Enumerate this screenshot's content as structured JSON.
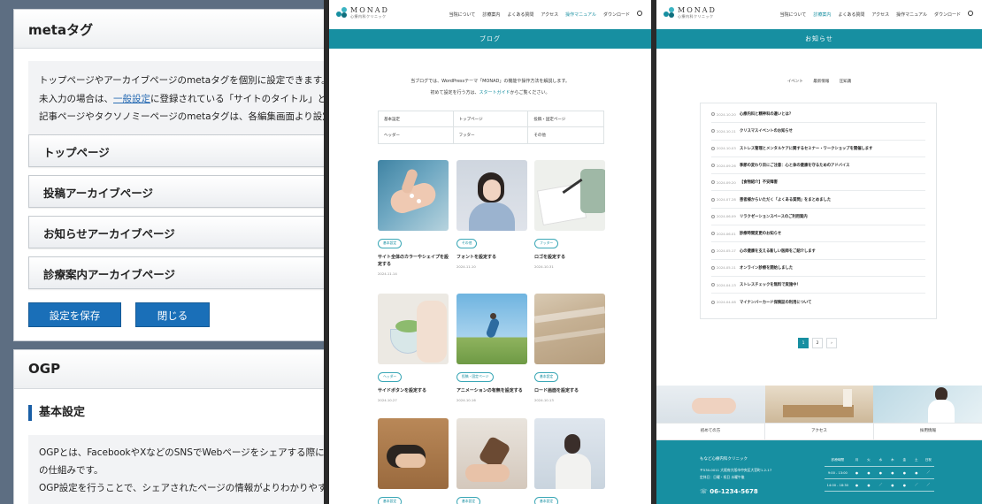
{
  "admin": {
    "meta_card": {
      "title": "metaタグ",
      "info_line1": "トップページやアーカイブページのmetaタグを個別に設定できます。",
      "info_line2_a": "未入力の場合は、",
      "info_line2_link": "一般設定",
      "info_line2_b": "に登録されている「サイトのタイトル」と「キャッチフ",
      "info_line3": "記事ページやタクソノミーページのmetaタグは、各編集画面より設定できます。",
      "accordions": [
        "トップページ",
        "投稿アーカイブページ",
        "お知らせアーカイブページ",
        "診療案内アーカイブページ"
      ],
      "save_label": "設定を保存",
      "close_label": "閉じる"
    },
    "ogp_card": {
      "title": "OGP",
      "subheading": "基本設定",
      "line1": "OGPとは、FacebookやXなどのSNSでWebページをシェアする際に、記事タイト",
      "line2": "の仕組みです。",
      "line3": "OGP設定を行うことで、シェアされたページの情報がよりわかりやすく魅力的に表"
    }
  },
  "site": {
    "logo_text": "MONAD",
    "logo_sub": "心療内科クリニック",
    "nav": [
      "当院について",
      "診療案内",
      "よくある質問",
      "アクセス",
      "操作マニュアル",
      "ダウンロード"
    ],
    "colors": {
      "accent": "#178fa1",
      "admin_button": "#1a6fb8"
    }
  },
  "blog": {
    "band_title": "ブログ",
    "intro_line1": "当ブログでは、WordPressテーマ「MONAD」の機能や操作方法を解説します。",
    "intro_line2_a": "初めて設定を行う方は、",
    "intro_line2_link": "スタートガイド",
    "intro_line2_b": "からご覧ください。",
    "categories": [
      "基本設定",
      "トップページ",
      "投稿・固定ページ",
      "ヘッダー",
      "フッター",
      "その他"
    ],
    "posts": [
      {
        "tag": "基本設定",
        "title": "サイト全体のカラーやシェイプを設定する",
        "date": "2024.11.14"
      },
      {
        "tag": "その他",
        "title": "フォントを設定する",
        "date": "2024.11.10"
      },
      {
        "tag": "フッター",
        "title": "ロゴを設定する",
        "date": "2024.10.31"
      },
      {
        "tag": "ヘッダー",
        "title": "サイドボタンを設定する",
        "date": "2024.10.27"
      },
      {
        "tag": "投稿・固定ページ",
        "title": "アニメーションの有無を設定する",
        "date": "2024.10.16"
      },
      {
        "tag": "基本設定",
        "title": "ロード画面を設定する",
        "date": "2024.10.13"
      },
      {
        "tag": "基本設定",
        "title": "",
        "date": ""
      },
      {
        "tag": "基本設定",
        "title": "",
        "date": ""
      },
      {
        "tag": "基本設定",
        "title": "",
        "date": ""
      }
    ]
  },
  "news": {
    "band_title": "お知らせ",
    "tabs": [
      "イベント",
      "最新情報",
      "圧知識"
    ],
    "items": [
      {
        "date": "2024.10.20",
        "title": "心療内科と精神科の違いとは？"
      },
      {
        "date": "2024.10.11",
        "title": "クリスマスイベントのお知らせ"
      },
      {
        "date": "2024.10.03",
        "title": "ストレス管理とメンタルケアに関するセミナー・ワークショップを開催します"
      },
      {
        "date": "2024.09.26",
        "title": "季節の変わり目にご注意：心と体の健康を守るためのアドバイス"
      },
      {
        "date": "2024.09.20",
        "title": "【食物紹介】不安障害"
      },
      {
        "date": "2024.07.28",
        "title": "患者様からいただく「よくある質問」をまとめました"
      },
      {
        "date": "2024.06.09",
        "title": "リラクゼーションスペースのご利用案内"
      },
      {
        "date": "2024.06.01",
        "title": "診療時間変更のお知らせ"
      },
      {
        "date": "2024.05.17",
        "title": "心の健康を支える新しい医師をご紹介します"
      },
      {
        "date": "2024.05.11",
        "title": "オンライン診療を開始しました"
      },
      {
        "date": "2024.04.13",
        "title": "ストレスチェックを無料で実施中！"
      },
      {
        "date": "2024.04.08",
        "title": "マイナンバーカード保険証の利用について"
      }
    ],
    "pager": [
      "1",
      "2",
      "›"
    ],
    "quick_links": [
      "初めての方",
      "アクセス",
      "採用情報"
    ],
    "footer": {
      "name": "もなど心療内科クリニック",
      "address": "〒530-0011 大阪府大阪市中央区大宮町1-2-17",
      "closed": "定休日：日曜・祝日 水曜午後",
      "tel": "06-1234-5678",
      "hours_header": [
        "診療時間",
        "月",
        "火",
        "水",
        "木",
        "金",
        "土",
        "日祝"
      ],
      "hours_rows": [
        [
          "9:00 - 13:00",
          "●",
          "●",
          "●",
          "●",
          "●",
          "●",
          "／"
        ],
        [
          "14:00 - 18:30",
          "●",
          "●",
          "／",
          "●",
          "●",
          "／",
          "／"
        ]
      ]
    }
  }
}
